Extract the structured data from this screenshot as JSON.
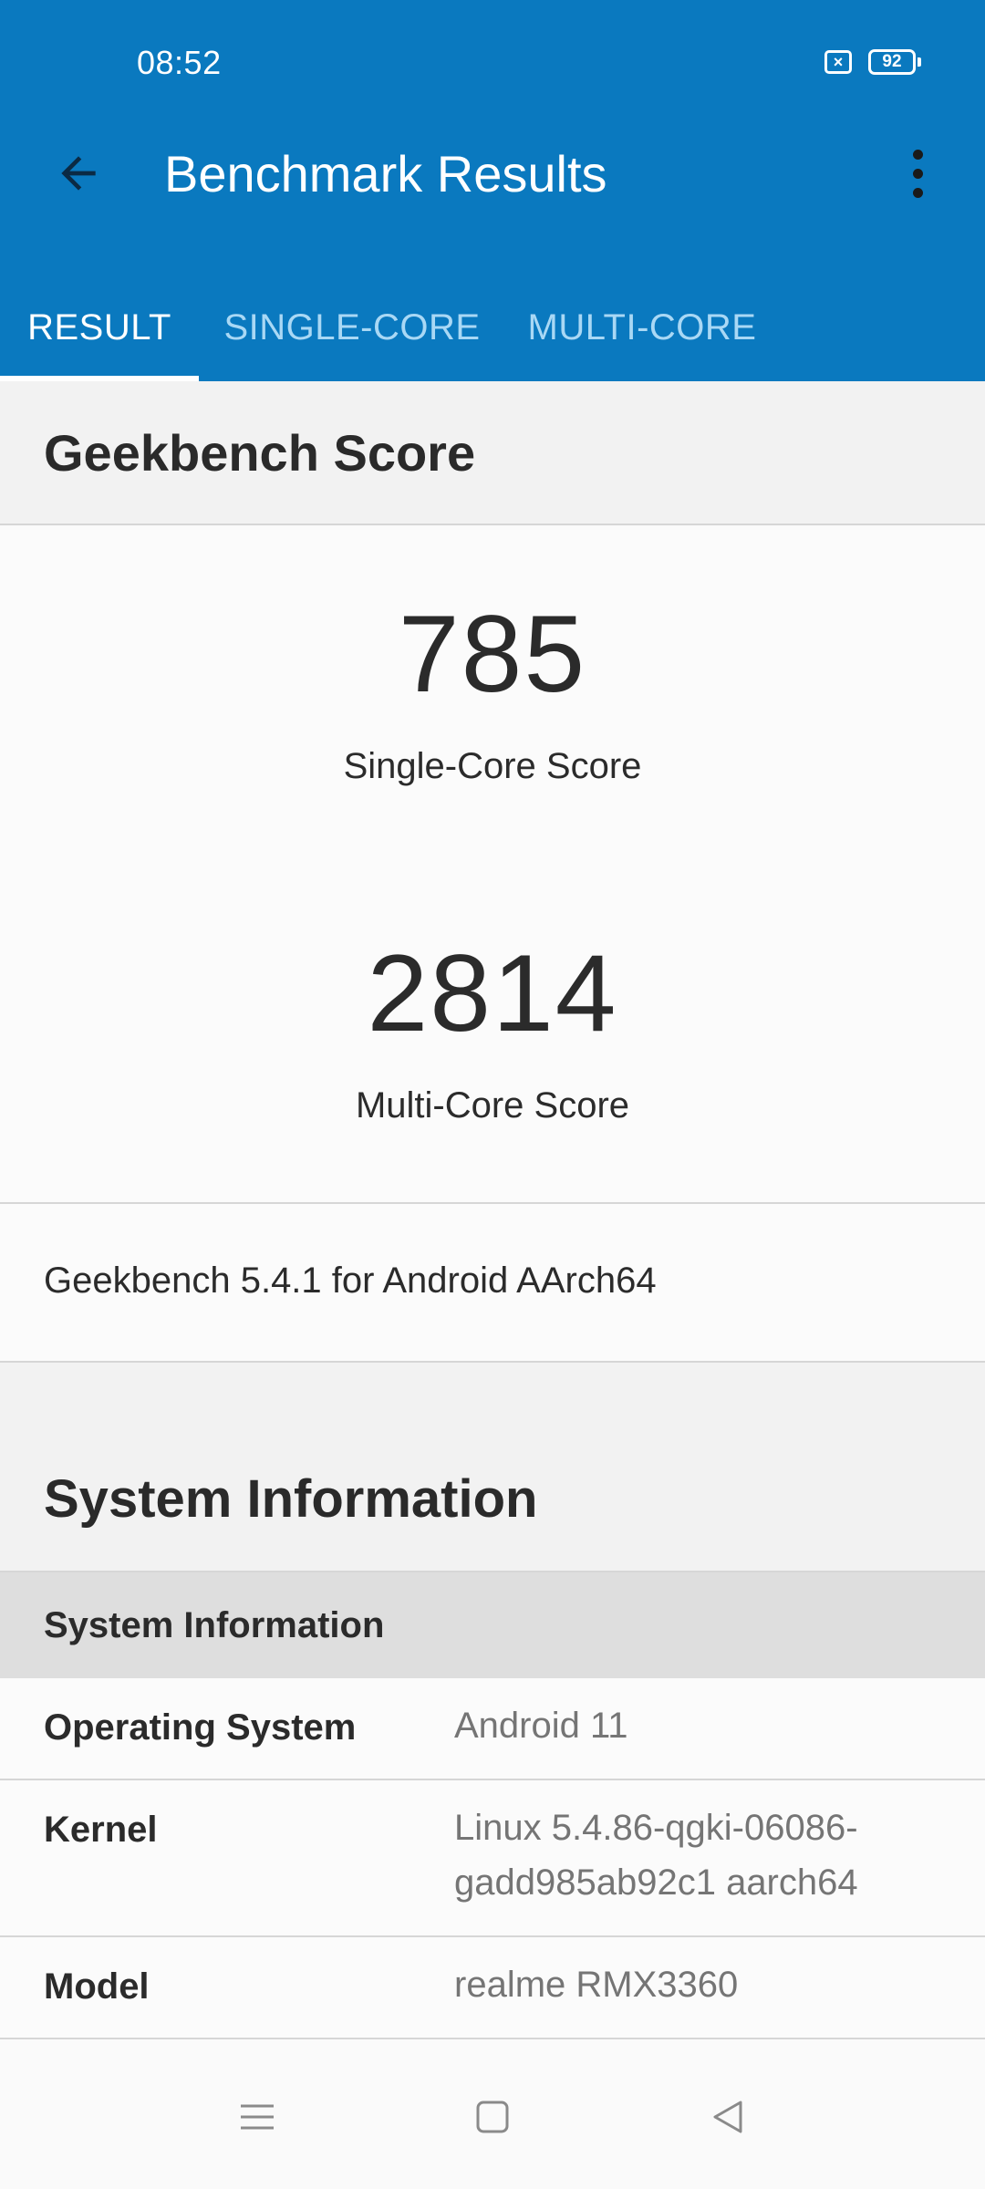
{
  "status_bar": {
    "time": "08:52",
    "battery_level": "92",
    "icons": [
      "sim-x-icon",
      "battery-icon"
    ]
  },
  "app_bar": {
    "title": "Benchmark Results",
    "back_icon": "arrow-left-icon",
    "overflow_icon": "more-vert-icon",
    "accent_color": "#0a79bf"
  },
  "tabs": [
    {
      "label": "RESULT",
      "active": true
    },
    {
      "label": "SINGLE-CORE",
      "active": false
    },
    {
      "label": "MULTI-CORE",
      "active": false
    }
  ],
  "geekbench_score": {
    "title": "Geekbench Score",
    "single_core": {
      "value": "785",
      "label": "Single-Core Score"
    },
    "multi_core": {
      "value": "2814",
      "label": "Multi-Core Score"
    },
    "version": "Geekbench 5.4.1 for Android AArch64"
  },
  "system_information": {
    "title": "System Information",
    "subheader": "System Information",
    "rows": [
      {
        "key": "Operating System",
        "value": "Android 11"
      },
      {
        "key": "Kernel",
        "value": "Linux 5.4.86-qgki-06086-gadd985ab92c1 aarch64"
      },
      {
        "key": "Model",
        "value": "realme RMX3360"
      }
    ]
  },
  "nav_bar": {
    "icons": [
      "menu-icon",
      "home-icon",
      "back-triangle-icon"
    ]
  }
}
